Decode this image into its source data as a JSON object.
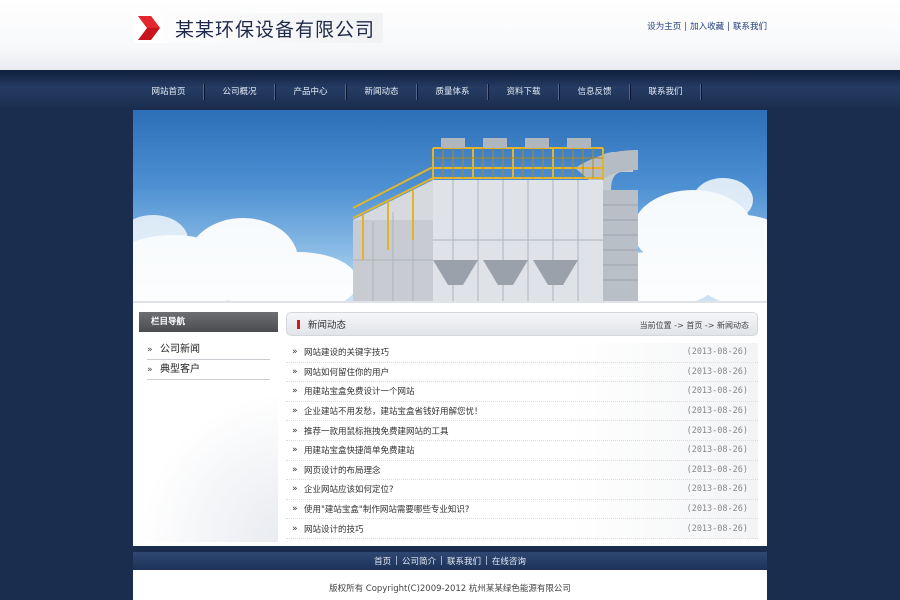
{
  "header": {
    "company_name": "某某环保设备有限公司",
    "links": [
      "设为主页",
      "加入收藏",
      "联系我们"
    ]
  },
  "nav": {
    "items": [
      "网站首页",
      "公司概况",
      "产品中心",
      "新闻动态",
      "质量体系",
      "资料下载",
      "信息反馈",
      "联系我们"
    ]
  },
  "sidebar": {
    "title": "栏目导航",
    "items": [
      "公司新闻",
      "典型客户"
    ]
  },
  "main": {
    "title": "新闻动态",
    "breadcrumb": "当前位置 -> 首页 -> 新闻动态",
    "news": [
      {
        "title": "网站建设的关键字技巧",
        "date": "(2013-08-26)"
      },
      {
        "title": "网站如何留住你的用户",
        "date": "(2013-08-26)"
      },
      {
        "title": "用建站宝盒免费设计一个网站",
        "date": "(2013-08-26)"
      },
      {
        "title": "企业建站不用发愁，建站宝盒省钱好用解您忧！",
        "date": "(2013-08-26)"
      },
      {
        "title": "推荐一款用鼠标拖拽免费建网站的工具",
        "date": "(2013-08-26)"
      },
      {
        "title": "用建站宝盒快捷简单免费建站",
        "date": "(2013-08-26)"
      },
      {
        "title": "网页设计的布局理念",
        "date": "(2013-08-26)"
      },
      {
        "title": "企业网站应该如何定位?",
        "date": "(2013-08-26)"
      },
      {
        "title": "使用\"建站宝盒\"制作网站需要哪些专业知识?",
        "date": "(2013-08-26)"
      },
      {
        "title": "网站设计的技巧",
        "date": "(2013-08-26)"
      }
    ]
  },
  "footer": {
    "links": [
      "首页",
      "公司简介",
      "联系我们",
      "在线咨询"
    ],
    "copyright": "版权所有 Copyright(C)2009-2012 杭州某某绿色能源有限公司"
  },
  "colors": {
    "page_bg": "#1b2d4e",
    "accent_red": "#cc1b1b",
    "link_blue": "#1f3d7a"
  }
}
